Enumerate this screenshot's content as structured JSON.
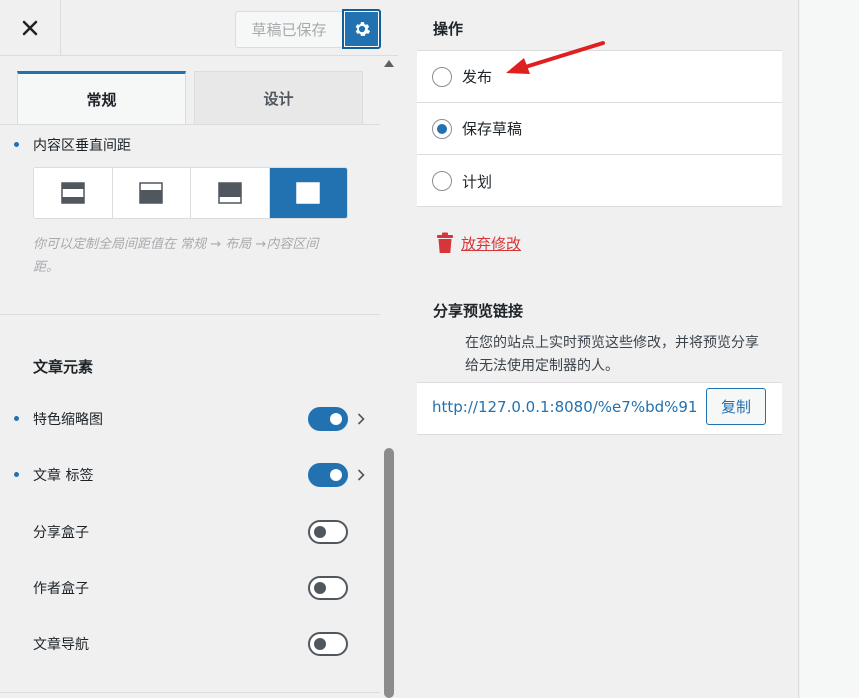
{
  "topbar": {
    "close_icon": "close-icon",
    "draft_saved_label": "草稿已保存",
    "settings_icon": "gear-icon"
  },
  "tabs": [
    {
      "label": "常规",
      "active": true
    },
    {
      "label": "设计",
      "active": false
    }
  ],
  "content_spacing": {
    "label": "内容区垂直间距",
    "options": [
      "spacing-top-bottom-icon",
      "spacing-bottom-icon",
      "spacing-top-icon",
      "spacing-none-icon"
    ],
    "active_index": 3,
    "help_text": "你可以定制全局间距值在 常规 → 布局 →内容区间距。"
  },
  "post_elements": {
    "title": "文章元素",
    "items": [
      {
        "label": "特色缩略图",
        "on": true,
        "has_settings": true
      },
      {
        "label": "文章 标签",
        "on": true,
        "has_settings": true
      },
      {
        "label": "分享盒子",
        "on": false,
        "has_settings": false
      },
      {
        "label": "作者盒子",
        "on": false,
        "has_settings": false
      },
      {
        "label": "文章导航",
        "on": false,
        "has_settings": false
      }
    ]
  },
  "actions": {
    "title": "操作",
    "options": [
      {
        "label": "发布",
        "checked": false
      },
      {
        "label": "保存草稿",
        "checked": true
      },
      {
        "label": "计划",
        "checked": false
      }
    ],
    "discard_label": "放弃修改"
  },
  "share": {
    "title": "分享预览链接",
    "description": "在您的站点上实时预览这些修改，并将预览分享给无法使用定制器的人。",
    "url": "http://127.0.0.1:8080/%e7%bd%91",
    "copy_label": "复制"
  },
  "colors": {
    "accent": "#2271b1",
    "danger": "#d63638",
    "annotation": "#e02020"
  }
}
